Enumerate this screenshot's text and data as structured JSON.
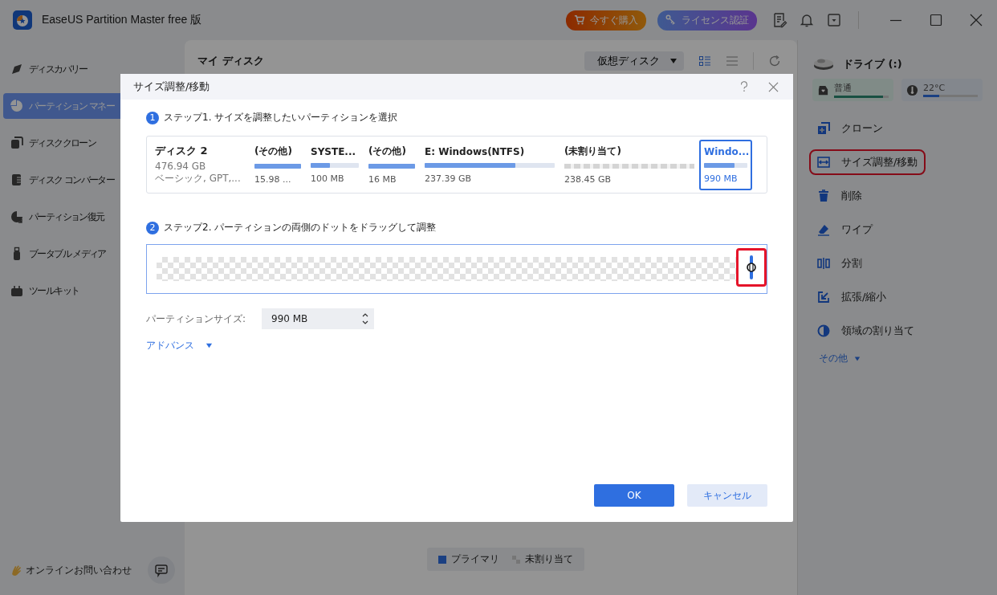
{
  "window": {
    "title": "EaseUS Partition Master free 版",
    "buttons": [
      {
        "label": "今すぐ購入",
        "kind": "buy"
      },
      {
        "label": "ライセンス認証",
        "kind": "license"
      }
    ]
  },
  "sidebar": {
    "items": [
      {
        "label": "ディスカバリー",
        "selected": false
      },
      {
        "label": "パーティション マネー",
        "selected": true
      },
      {
        "label": "ディスククローン",
        "selected": false
      },
      {
        "label": "ディスク コンバーター",
        "selected": false
      },
      {
        "label": "パーティション復元",
        "selected": false
      },
      {
        "label": "ブータブル メディア",
        "selected": false
      },
      {
        "label": "ツールキット",
        "selected": false
      }
    ],
    "contact": "オンラインお問い合わせ"
  },
  "main": {
    "title": "マイ ディスク",
    "dropdown": "仮想ディスク",
    "views": [
      {
        "kind": "grid",
        "selected": true
      },
      {
        "kind": "list",
        "selected": false
      }
    ],
    "legend": [
      {
        "label": "プライマリ",
        "kind": "primary"
      },
      {
        "label": "未割り当て",
        "kind": "unallocated"
      }
    ]
  },
  "right_panel": {
    "drive": "ドライブ (:)",
    "health": [
      {
        "label": "普通",
        "kind": "health",
        "level": 0.9
      },
      {
        "label": "22°C",
        "kind": "temperature",
        "level": 0.3
      }
    ],
    "actions": [
      {
        "label": "クローン",
        "highlighted": false
      },
      {
        "label": "サイズ調整/移動",
        "highlighted": true
      },
      {
        "label": "削除",
        "highlighted": false
      },
      {
        "label": "ワイプ",
        "highlighted": false
      },
      {
        "label": "分割",
        "highlighted": false
      },
      {
        "label": "拡張/縮小",
        "highlighted": false
      },
      {
        "label": "領域の割り当て",
        "highlighted": false
      }
    ],
    "more": "その他"
  },
  "dialog": {
    "title": "サイズ調整/移動",
    "step1": {
      "number": "1",
      "label": "ステップ1. サイズを調整したいパーティションを選択"
    },
    "disk": {
      "name": "ディスク 2",
      "size": "476.94 GB",
      "type": "ベーシック, GPT,..."
    },
    "partitions": [
      {
        "name": "(その他)",
        "size": "15.98 ...",
        "kind": "used",
        "level": 1,
        "selected": false
      },
      {
        "name": "SYSTE...",
        "size": "100 MB",
        "kind": "used",
        "level": 0.4,
        "selected": false
      },
      {
        "name": "(その他)",
        "size": "16 MB",
        "kind": "used",
        "level": 1,
        "selected": false
      },
      {
        "name": "E: Windows(NTFS)",
        "size": "237.39 GB",
        "kind": "used",
        "level": 0.7,
        "selected": false
      },
      {
        "name": "(未割り当て)",
        "size": "238.45 GB",
        "kind": "unallocated",
        "selected": false
      },
      {
        "name": "Windo...",
        "size": "990 MB",
        "kind": "used",
        "level": 0.7,
        "selected": true
      }
    ],
    "step2": {
      "number": "2",
      "label": "ステップ2. パーティションの両側のドットをドラッグして調整"
    },
    "slider": {
      "level": 1,
      "highlighted": true
    },
    "size_field": {
      "label": "パーティションサイズ:",
      "value": "990 MB"
    },
    "advanced": "アドバンス",
    "buttons": [
      {
        "label": "OK",
        "kind": "primary"
      },
      {
        "label": "キャンセル",
        "kind": "secondary"
      }
    ]
  }
}
